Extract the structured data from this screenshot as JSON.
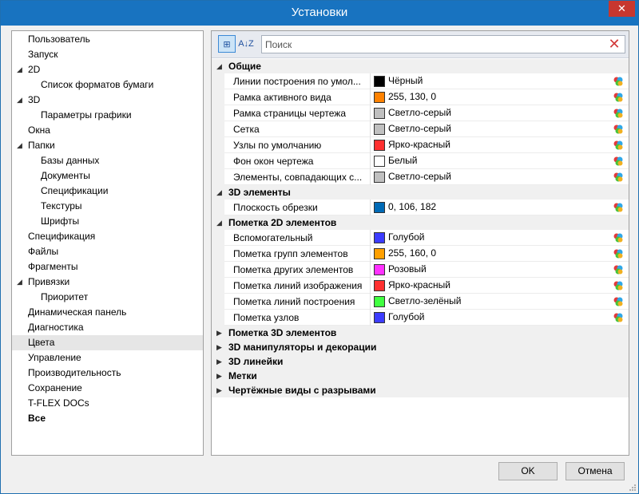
{
  "window": {
    "title": "Установки"
  },
  "tree": [
    {
      "label": "Пользователь",
      "level": 0,
      "arrow": ""
    },
    {
      "label": "Запуск",
      "level": 0,
      "arrow": ""
    },
    {
      "label": "2D",
      "level": 0,
      "arrow": "◢"
    },
    {
      "label": "Список форматов бумаги",
      "level": 1,
      "arrow": ""
    },
    {
      "label": "3D",
      "level": 0,
      "arrow": "◢"
    },
    {
      "label": "Параметры графики",
      "level": 1,
      "arrow": ""
    },
    {
      "label": "Окна",
      "level": 0,
      "arrow": ""
    },
    {
      "label": "Папки",
      "level": 0,
      "arrow": "◢"
    },
    {
      "label": "Базы данных",
      "level": 1,
      "arrow": ""
    },
    {
      "label": "Документы",
      "level": 1,
      "arrow": ""
    },
    {
      "label": "Спецификации",
      "level": 1,
      "arrow": ""
    },
    {
      "label": "Текстуры",
      "level": 1,
      "arrow": ""
    },
    {
      "label": "Шрифты",
      "level": 1,
      "arrow": ""
    },
    {
      "label": "Спецификация",
      "level": 0,
      "arrow": ""
    },
    {
      "label": "Файлы",
      "level": 0,
      "arrow": ""
    },
    {
      "label": "Фрагменты",
      "level": 0,
      "arrow": ""
    },
    {
      "label": "Привязки",
      "level": 0,
      "arrow": "◢"
    },
    {
      "label": "Приоритет",
      "level": 1,
      "arrow": ""
    },
    {
      "label": "Динамическая панель",
      "level": 0,
      "arrow": ""
    },
    {
      "label": "Диагностика",
      "level": 0,
      "arrow": ""
    },
    {
      "label": "Цвета",
      "level": 0,
      "arrow": "",
      "selected": true
    },
    {
      "label": "Управление",
      "level": 0,
      "arrow": ""
    },
    {
      "label": "Производительность",
      "level": 0,
      "arrow": ""
    },
    {
      "label": "Сохранение",
      "level": 0,
      "arrow": ""
    },
    {
      "label": "T-FLEX DOCs",
      "level": 0,
      "arrow": ""
    },
    {
      "label": "Все",
      "level": 0,
      "arrow": "",
      "bold": true
    }
  ],
  "toolbar": {
    "categorized_label": "⊞",
    "sort_label": "A↓Z",
    "search_placeholder": "Поиск",
    "clear_label": "✕"
  },
  "grid": [
    {
      "type": "cat",
      "label": "Общие",
      "arrow": "◢"
    },
    {
      "type": "prop",
      "name": "Линии построения по умол...",
      "value": "Чёрный",
      "color": "#000000"
    },
    {
      "type": "prop",
      "name": "Рамка активного вида",
      "value": "255, 130, 0",
      "color": "#ff8200"
    },
    {
      "type": "prop",
      "name": "Рамка страницы чертежа",
      "value": "Светло-серый",
      "color": "#c0c0c0"
    },
    {
      "type": "prop",
      "name": "Сетка",
      "value": "Светло-серый",
      "color": "#c0c0c0"
    },
    {
      "type": "prop",
      "name": "Узлы по умолчанию",
      "value": "Ярко-красный",
      "color": "#ff3030"
    },
    {
      "type": "prop",
      "name": "Фон окон чертежа",
      "value": "Белый",
      "color": "#ffffff"
    },
    {
      "type": "prop",
      "name": "Элементы, совпадающих с...",
      "value": "Светло-серый",
      "color": "#c0c0c0"
    },
    {
      "type": "cat",
      "label": "3D элементы",
      "arrow": "◢"
    },
    {
      "type": "prop",
      "name": "Плоскость обрезки",
      "value": "0, 106, 182",
      "color": "#006ab6"
    },
    {
      "type": "cat",
      "label": "Пометка 2D элементов",
      "arrow": "◢"
    },
    {
      "type": "prop",
      "name": "Вспомогательный",
      "value": "Голубой",
      "color": "#3c3cff"
    },
    {
      "type": "prop",
      "name": "Пометка групп элементов",
      "value": "255, 160, 0",
      "color": "#ffa000"
    },
    {
      "type": "prop",
      "name": "Пометка других элементов",
      "value": "Розовый",
      "color": "#ff30ff"
    },
    {
      "type": "prop",
      "name": "Пометка линий изображения",
      "value": "Ярко-красный",
      "color": "#ff3030"
    },
    {
      "type": "prop",
      "name": "Пометка линий построения",
      "value": "Светло-зелёный",
      "color": "#40ff40"
    },
    {
      "type": "prop",
      "name": "Пометка узлов",
      "value": "Голубой",
      "color": "#3c3cff"
    },
    {
      "type": "cat",
      "label": "Пометка 3D элементов",
      "arrow": "▶"
    },
    {
      "type": "cat",
      "label": "3D манипуляторы и декорации",
      "arrow": "▶"
    },
    {
      "type": "cat",
      "label": "3D линейки",
      "arrow": "▶"
    },
    {
      "type": "cat",
      "label": "Метки",
      "arrow": "▶"
    },
    {
      "type": "cat",
      "label": "Чертёжные виды с разрывами",
      "arrow": "▶"
    }
  ],
  "buttons": {
    "ok": "OK",
    "cancel": "Отмена"
  },
  "colors": {
    "titlebar": "#1873c0",
    "close": "#c7372f",
    "selection": "#e6e6e6"
  }
}
